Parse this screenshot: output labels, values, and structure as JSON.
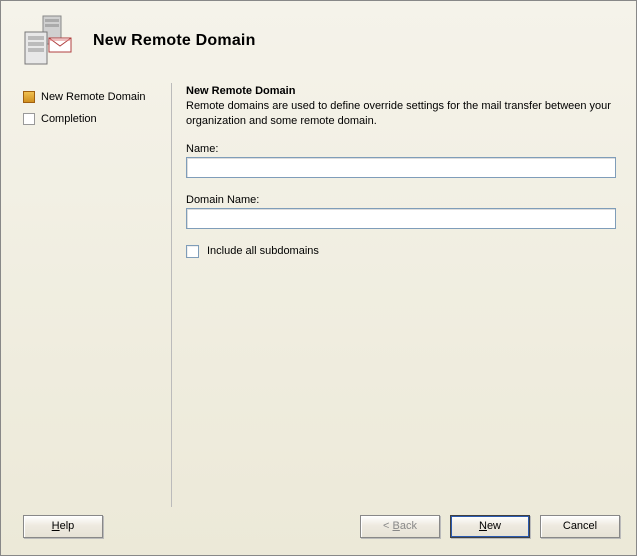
{
  "header": {
    "title": "New Remote Domain"
  },
  "sidebar": {
    "items": [
      {
        "label": "New Remote Domain",
        "state": "active"
      },
      {
        "label": "Completion",
        "state": "pending"
      }
    ]
  },
  "main": {
    "title": "New Remote Domain",
    "description": "Remote domains are used to define override settings for the mail transfer between your organization and some remote domain.",
    "name_label": "Name:",
    "name_value": "",
    "domain_label": "Domain Name:",
    "domain_value": "",
    "include_subdomains_label": "Include all subdomains",
    "include_subdomains_checked": false
  },
  "footer": {
    "help": "Help",
    "back": "< Back",
    "back_enabled": false,
    "next": "New",
    "cancel": "Cancel"
  }
}
